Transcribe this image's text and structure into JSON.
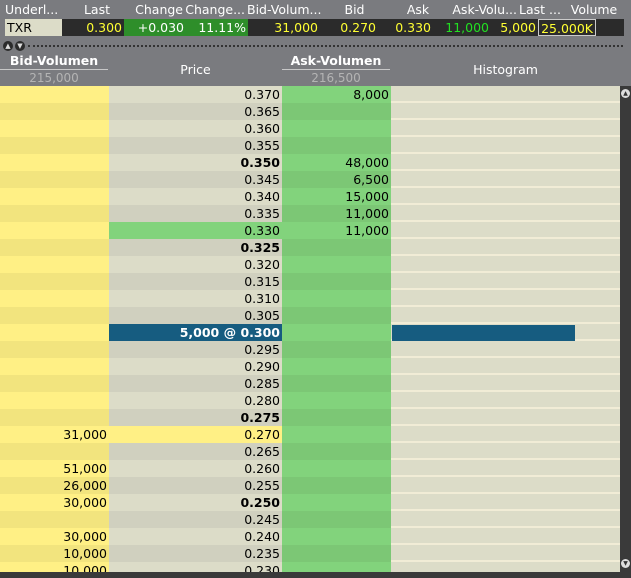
{
  "quote": {
    "headers": [
      "Underl...",
      "Last",
      "Change",
      "Change...",
      "Bid-Volum...",
      "Bid",
      "Ask",
      "Ask-Volu...",
      "Last ...",
      "Volume"
    ],
    "values": {
      "underlying": "TXR",
      "last": "0.300",
      "change": "+0.030",
      "change_pct": "11.11%",
      "bid_volume": "31,000",
      "bid": "0.270",
      "ask": "0.330",
      "ask_volume": "11,000",
      "last_size": "5,000",
      "volume": "25.000K"
    }
  },
  "ladder": {
    "columns": {
      "bid_volume": "Bid-Volumen",
      "bid_total": "215,000",
      "price": "Price",
      "ask_volume": "Ask-Volumen",
      "ask_total": "216,500",
      "histogram": "Histogram"
    },
    "last_trade_label": "5,000 @ 0.300",
    "last_trade_histogram_fraction": 0.8,
    "rows": [
      {
        "price": "0.370",
        "ask": "8,000"
      },
      {
        "price": "0.365"
      },
      {
        "price": "0.360"
      },
      {
        "price": "0.355"
      },
      {
        "price": "0.350",
        "ask": "48,000",
        "bold": true
      },
      {
        "price": "0.345",
        "ask": "6,500"
      },
      {
        "price": "0.340",
        "ask": "15,000"
      },
      {
        "price": "0.335",
        "ask": "11,000"
      },
      {
        "price": "0.330",
        "ask": "11,000",
        "best_ask": true
      },
      {
        "price": "0.325",
        "bold": true
      },
      {
        "price": "0.320"
      },
      {
        "price": "0.315"
      },
      {
        "price": "0.310"
      },
      {
        "price": "0.305"
      },
      {
        "price": "0.300",
        "current": true,
        "bold": true
      },
      {
        "price": "0.295"
      },
      {
        "price": "0.290"
      },
      {
        "price": "0.285"
      },
      {
        "price": "0.280"
      },
      {
        "price": "0.275",
        "bold": true
      },
      {
        "price": "0.270",
        "bid": "31,000",
        "best_bid": true
      },
      {
        "price": "0.265"
      },
      {
        "price": "0.260",
        "bid": "51,000"
      },
      {
        "price": "0.255",
        "bid": "26,000"
      },
      {
        "price": "0.250",
        "bid": "30,000",
        "bold": true
      },
      {
        "price": "0.245"
      },
      {
        "price": "0.240",
        "bid": "30,000"
      },
      {
        "price": "0.235",
        "bid": "10,000"
      },
      {
        "price": "0.230",
        "bid": "10,000"
      }
    ]
  }
}
